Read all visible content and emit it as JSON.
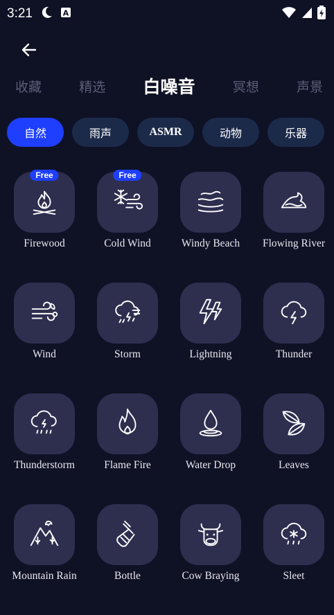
{
  "status": {
    "time": "3:21"
  },
  "nav": {
    "back_label": "back"
  },
  "tabs": [
    {
      "label": "收藏",
      "active": false
    },
    {
      "label": "精选",
      "active": false
    },
    {
      "label": "白噪音",
      "active": true
    },
    {
      "label": "冥想",
      "active": false
    },
    {
      "label": "声景",
      "active": false
    }
  ],
  "chips": [
    {
      "label": "自然",
      "active": true
    },
    {
      "label": "雨声",
      "active": false
    },
    {
      "label": "ASMR",
      "active": false
    },
    {
      "label": "动物",
      "active": false
    },
    {
      "label": "乐器",
      "active": false
    }
  ],
  "sounds": [
    {
      "label": "Firewood",
      "icon": "campfire-icon",
      "badge": "Free"
    },
    {
      "label": "Cold Wind",
      "icon": "snow-wind-icon",
      "badge": "Free"
    },
    {
      "label": "Windy Beach",
      "icon": "windy-beach-icon",
      "badge": ""
    },
    {
      "label": "Flowing River",
      "icon": "river-icon",
      "badge": ""
    },
    {
      "label": "Wind",
      "icon": "wind-icon",
      "badge": ""
    },
    {
      "label": "Storm",
      "icon": "storm-icon",
      "badge": ""
    },
    {
      "label": "Lightning",
      "icon": "lightning-icon",
      "badge": ""
    },
    {
      "label": "Thunder",
      "icon": "thunder-icon",
      "badge": ""
    },
    {
      "label": "Thunderstorm",
      "icon": "thunderstorm-icon",
      "badge": ""
    },
    {
      "label": "Flame Fire",
      "icon": "flame-icon",
      "badge": ""
    },
    {
      "label": "Water Drop",
      "icon": "water-drop-icon",
      "badge": ""
    },
    {
      "label": "Leaves",
      "icon": "leaves-icon",
      "badge": ""
    },
    {
      "label": "Mountain Rain",
      "icon": "mountain-icon",
      "badge": ""
    },
    {
      "label": "Bottle",
      "icon": "bottle-icon",
      "badge": ""
    },
    {
      "label": "Cow Braying",
      "icon": "cow-icon",
      "badge": ""
    },
    {
      "label": "Sleet",
      "icon": "sleet-icon",
      "badge": ""
    }
  ],
  "colors": {
    "background": "#0f1125",
    "accent": "#1f3fff",
    "tile": "#2e2e4f",
    "chip": "#1c2a4a"
  }
}
